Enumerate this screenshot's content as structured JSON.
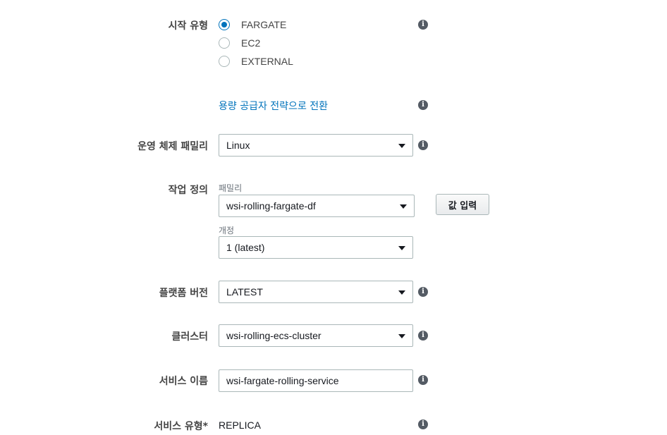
{
  "launch_type": {
    "label": "시작 유형",
    "options": [
      "FARGATE",
      "EC2",
      "EXTERNAL"
    ],
    "selected": "FARGATE"
  },
  "capacity_link": "용량 공급자 전략으로 전환",
  "os_family": {
    "label": "운영 체제 패밀리",
    "value": "Linux"
  },
  "task_definition": {
    "label": "작업 정의",
    "family_label": "패밀리",
    "family_value": "wsi-rolling-fargate-df",
    "revision_label": "개정",
    "revision_value": "1 (latest)",
    "enter_value_button": "값 입력"
  },
  "platform_version": {
    "label": "플랫폼 버전",
    "value": "LATEST"
  },
  "cluster": {
    "label": "클러스터",
    "value": "wsi-rolling-ecs-cluster"
  },
  "service_name": {
    "label": "서비스 이름",
    "value": "wsi-fargate-rolling-service"
  },
  "service_type": {
    "label": "서비스 유형*",
    "value": "REPLICA"
  },
  "info_icon_glyph": "i",
  "colors": {
    "accent": "#0073bb",
    "label": "#444444",
    "border": "#aab7b8",
    "info": "#545b64"
  }
}
